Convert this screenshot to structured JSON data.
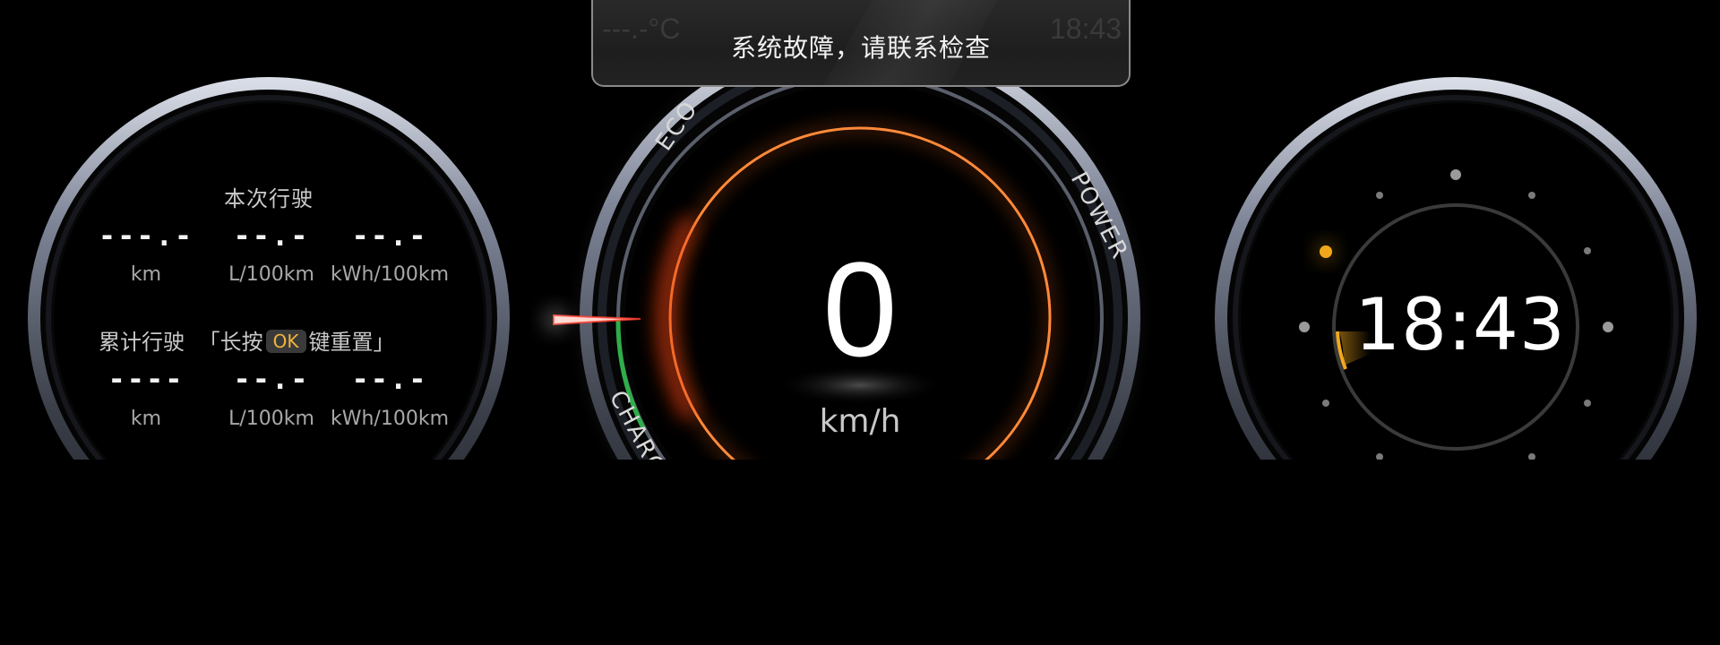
{
  "warning": {
    "message": "系统故障，请联系检查",
    "ghost_temperature": "---.-°C",
    "ghost_time": "18:43"
  },
  "trip": {
    "current_title": "本次行驶",
    "current_values": [
      "---.-",
      "--.-",
      "--.-"
    ],
    "current_units": [
      "km",
      "L/100km",
      "kWh/100km"
    ],
    "cumulative_title": "累计行驶",
    "reset_prefix": "「长按",
    "reset_key": "OK",
    "reset_suffix": "键重置」",
    "cumulative_values": [
      "----",
      "--.-",
      "--.-"
    ],
    "cumulative_units": [
      "km",
      "L/100km",
      "kWh/100km"
    ]
  },
  "speedometer": {
    "speed": "0",
    "unit": "km/h",
    "zone_labels": {
      "eco": "ECO",
      "power": "POWER",
      "charge": "CHARG"
    }
  },
  "clock": {
    "time": "18:43"
  },
  "colors": {
    "accent_orange": "#ff6a1a",
    "charge_green": "#2fae4a",
    "clock_amber": "#f2a81c",
    "ok_key_text": "#f0b43a"
  }
}
